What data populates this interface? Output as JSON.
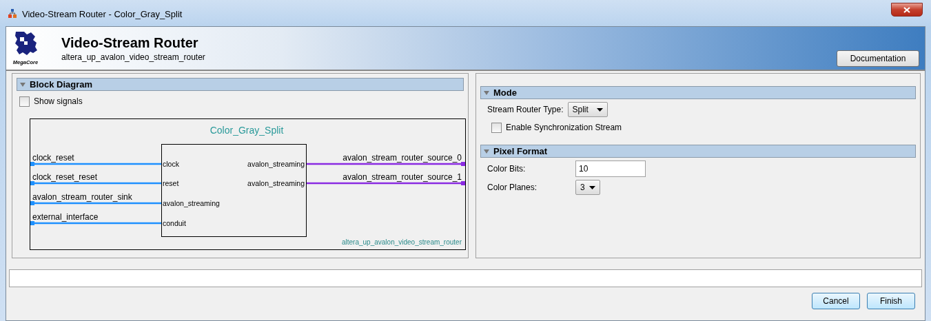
{
  "window": {
    "title": "Video-Stream Router - Color_Gray_Split"
  },
  "header": {
    "title": "Video-Stream Router",
    "subtitle": "altera_up_avalon_video_stream_router",
    "logo_text": "MegaCore",
    "documentation_button": "Documentation"
  },
  "block_diagram": {
    "title": "Block Diagram",
    "expanded": true,
    "show_signals": {
      "label": "Show signals",
      "checked": false
    },
    "diagram": {
      "instance": "Color_Gray_Split",
      "module": "altera_up_avalon_video_stream_router",
      "inputs": [
        {
          "external": "clock_reset",
          "port": "clock"
        },
        {
          "external": "clock_reset_reset",
          "port": "reset"
        },
        {
          "external": "avalon_stream_router_sink",
          "port": "avalon_streaming"
        },
        {
          "external": "external_interface",
          "port": "conduit"
        }
      ],
      "outputs": [
        {
          "external": "avalon_stream_router_source_0",
          "port": "avalon_streaming"
        },
        {
          "external": "avalon_stream_router_source_1",
          "port": "avalon_streaming"
        }
      ]
    }
  },
  "mode": {
    "title": "Mode",
    "expanded": true,
    "router_type": {
      "label": "Stream Router Type:",
      "value": "Split"
    },
    "sync_stream": {
      "label": "Enable Synchronization Stream",
      "checked": false
    }
  },
  "pixel_format": {
    "title": "Pixel Format",
    "expanded": true,
    "color_bits": {
      "label": "Color Bits:",
      "value": "10"
    },
    "color_planes": {
      "label": "Color Planes:",
      "value": "3"
    }
  },
  "buttons": [
    "Cancel",
    "Finish"
  ]
}
